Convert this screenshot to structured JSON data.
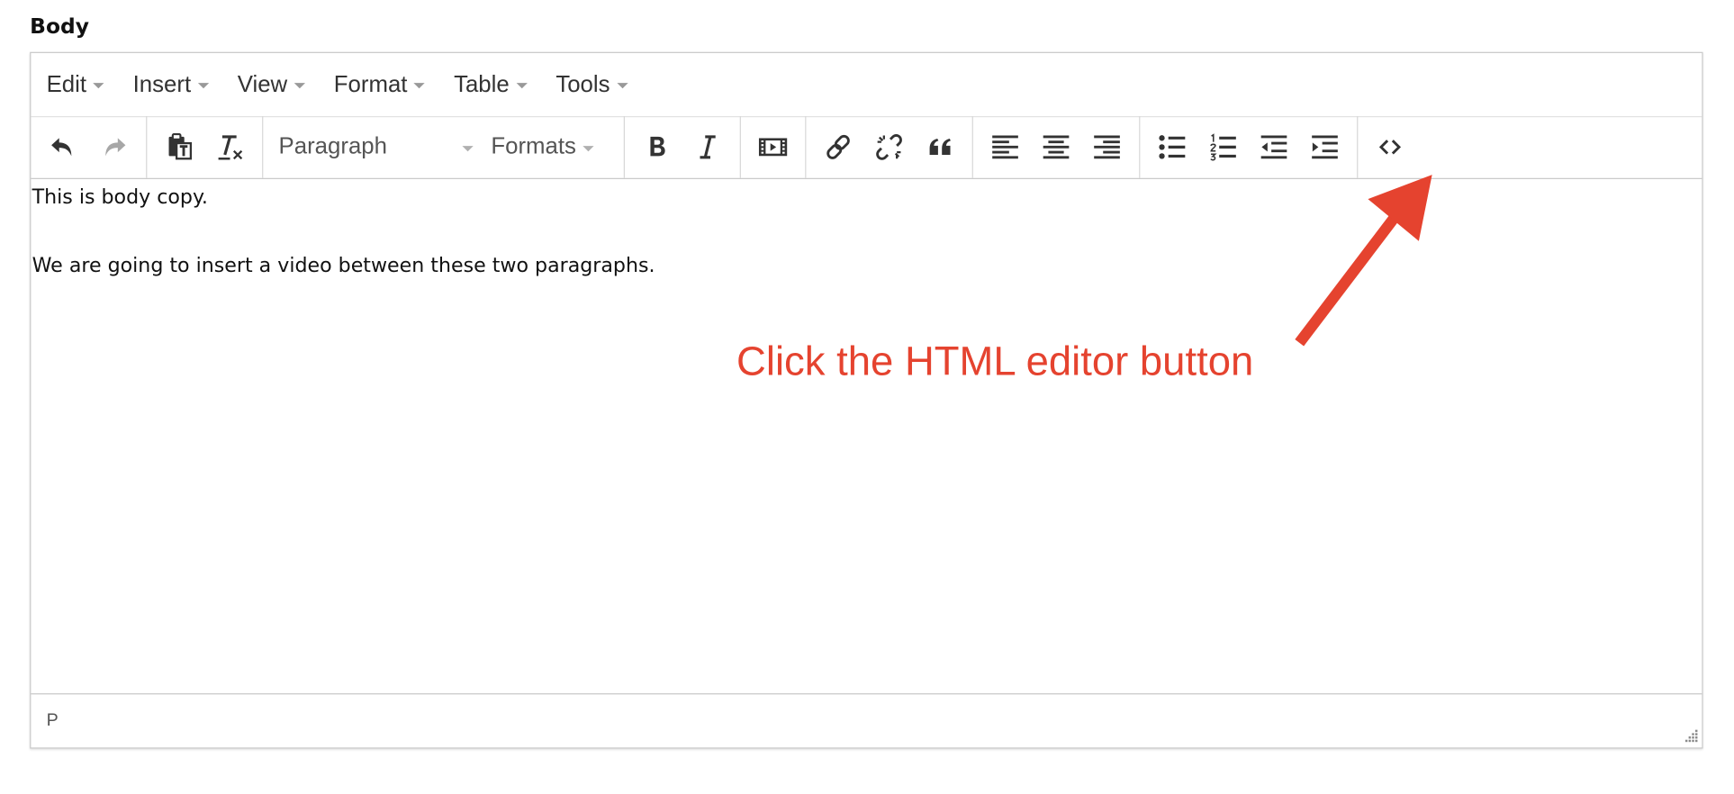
{
  "field": {
    "label": "Body"
  },
  "menubar": {
    "items": [
      {
        "label": "Edit"
      },
      {
        "label": "Insert"
      },
      {
        "label": "View"
      },
      {
        "label": "Format"
      },
      {
        "label": "Table"
      },
      {
        "label": "Tools"
      }
    ]
  },
  "toolbar": {
    "block_format": "Paragraph",
    "formats": "Formats",
    "icons": [
      "undo-icon",
      "redo-icon",
      "paste-text-icon",
      "clear-formatting-icon",
      "bold-icon",
      "italic-icon",
      "media-icon",
      "link-icon",
      "unlink-icon",
      "blockquote-icon",
      "align-left-icon",
      "align-center-icon",
      "align-right-icon",
      "bullet-list-icon",
      "numbered-list-icon",
      "outdent-icon",
      "indent-icon",
      "code-icon"
    ]
  },
  "content": {
    "paragraphs": [
      "This is body copy.",
      "We are going to insert a video between these two paragraphs."
    ]
  },
  "statusbar": {
    "path": "P"
  },
  "annotation": {
    "text": "Click the HTML editor button",
    "color": "#e5432f"
  }
}
